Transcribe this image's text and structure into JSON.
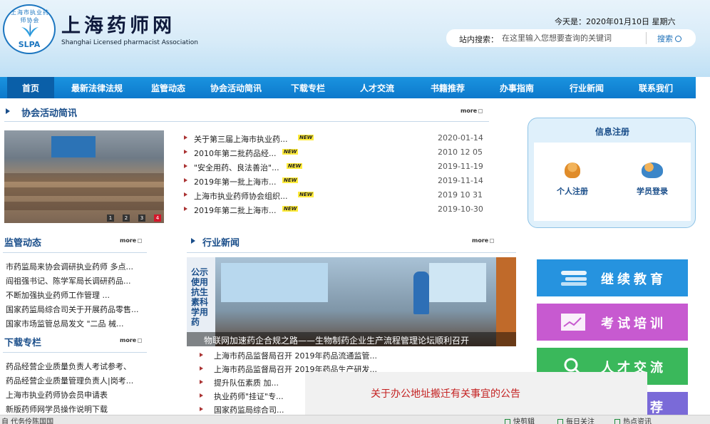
{
  "header": {
    "logo_arc_text": "上海市执业药师协会",
    "logo_abbr": "SLPA",
    "title": "上海药师网",
    "subtitle": "Shanghai Licensed pharmacist Association",
    "date": "今天是：2020年01月10日  星期六"
  },
  "search": {
    "label": "站内搜索：",
    "placeholder": "在这里输入您想要查询的关键词",
    "button": "搜索"
  },
  "nav": {
    "items": [
      "首页",
      "最新法律法规",
      "监管动态",
      "协会活动简讯",
      "下载专栏",
      "人才交流",
      "书籍推荐",
      "办事指南",
      "行业新闻",
      "联系我们"
    ]
  },
  "association_news": {
    "title": "协会活动简讯",
    "more": "more",
    "photo_dots": [
      "1",
      "2",
      "3",
      "4"
    ],
    "items": [
      {
        "text": "关于第三届上海市执业药...",
        "badge": "NEW",
        "date": "2020-01-14"
      },
      {
        "text": "2010年第二批药品经...",
        "badge": "NEW",
        "date": "2010 12 05"
      },
      {
        "text": "\"安全用药、良法善治\"...",
        "badge": "NEW",
        "date": "2019-11-19"
      },
      {
        "text": "2019年第一批上海市...",
        "badge": "NEW",
        "date": "2019-11-14"
      },
      {
        "text": "上海市执业药师协会组织...",
        "badge": "NEW",
        "date": "2019 10 31"
      },
      {
        "text": "2019年第二批上海市...",
        "badge": "NEW",
        "date": "2019-10-30"
      }
    ]
  },
  "registration": {
    "title": "信息注册",
    "personal": "个人注册",
    "member_login": "学员登录"
  },
  "regulation": {
    "title": "监管动态",
    "more": "more",
    "items": [
      "市药监局来协会调研执业药师 多点...",
      "阎祖强书记、陈学军局长调研药品...",
      "不断加强执业药师工作管理 ...",
      "国家药监局综合司关于开展药品零售...",
      "国家市场监管总局发文 \"二品   械..."
    ]
  },
  "downloads": {
    "title": "下载专栏",
    "more": "more",
    "items": [
      "药品经营企业质量负责人考试参考、",
      "药品经营企业质量管理负责人|岗考...",
      "上海市执业药师协会员申请表",
      "新版药师网学员操作说明下载"
    ]
  },
  "industry_news": {
    "title": "行业新闻",
    "more": "more",
    "photo_banner": "公示使用抗生素科学用药",
    "caption": "物联网加速药企合规之路——生物制药企业生产流程管理论坛顺利召开",
    "items": [
      "上海市药品监督局召开 2019年药品流通监管...",
      "上海市药品监督局召开 2019年药品生产研发...",
      "提升队伍素质 加...",
      "执业药师\"挂证\"专...",
      "国家药监局综合司..."
    ]
  },
  "tiles": [
    {
      "label": "继续教育",
      "color": "#2693df"
    },
    {
      "label": "考试培训",
      "color": "#c75ad0"
    },
    {
      "label": "人才交流",
      "color": "#3ab85b"
    },
    {
      "label": "书籍推荐",
      "color": "#7a6ad8"
    }
  ],
  "popup": {
    "text": "关于办公地址搬迁有关事宜的公告"
  },
  "statusbar": {
    "left": "自  代务伶陈国国",
    "items": [
      "快剪辑",
      "每日关注",
      "热点资讯"
    ]
  }
}
